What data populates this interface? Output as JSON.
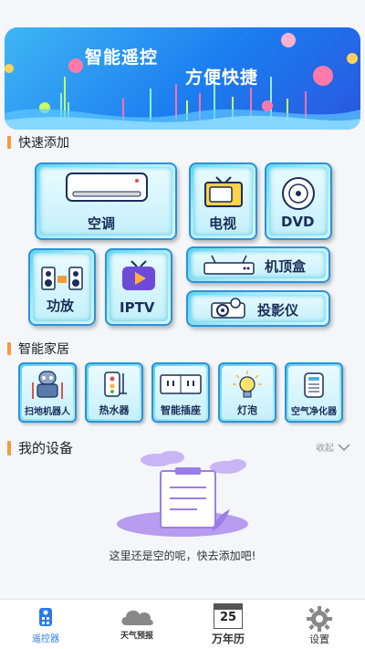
{
  "banner": {
    "title_1": "智能遥控",
    "title_2": "方便快捷"
  },
  "quick_add": {
    "title": "快速添加",
    "items": [
      {
        "label": "空调",
        "icon": "air-conditioner-icon"
      },
      {
        "label": "电视",
        "icon": "tv-icon"
      },
      {
        "label": "DVD",
        "icon": "dvd-icon"
      },
      {
        "label": "功放",
        "icon": "amplifier-icon"
      },
      {
        "label": "IPTV",
        "icon": "iptv-icon"
      },
      {
        "label": "机顶盒",
        "icon": "set-top-box-icon"
      },
      {
        "label": "投影仪",
        "icon": "projector-icon"
      }
    ]
  },
  "smart_home": {
    "title": "智能家居",
    "items": [
      {
        "label": "扫地机器人",
        "icon": "robot-vacuum-icon"
      },
      {
        "label": "热水器",
        "icon": "water-heater-icon"
      },
      {
        "label": "智能插座",
        "icon": "smart-socket-icon"
      },
      {
        "label": "灯泡",
        "icon": "light-bulb-icon"
      },
      {
        "label": "空气净化器",
        "icon": "air-purifier-icon"
      }
    ]
  },
  "my_devices": {
    "title": "我的设备",
    "collapse_label": "收起",
    "empty_text": "这里还是空的呢，快去添加吧!"
  },
  "bottom_nav": {
    "items": [
      {
        "label": "遥控器",
        "icon": "remote-icon",
        "active": true
      },
      {
        "label": "天气预报",
        "icon": "cloud-icon",
        "active": false
      },
      {
        "label": "万年历",
        "icon": "calendar-icon",
        "active": false,
        "day": "25"
      },
      {
        "label": "设置",
        "icon": "gear-icon",
        "active": false
      }
    ]
  },
  "colors": {
    "accent": "#f29b3c",
    "tile_border": "#2c93d8",
    "banner": "#1b7df0",
    "active_nav": "#2c7be5"
  }
}
